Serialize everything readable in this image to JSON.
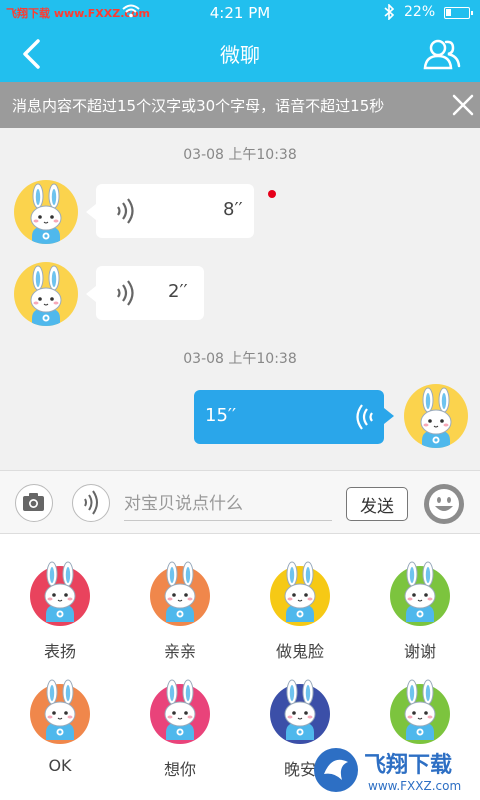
{
  "status_bar": {
    "carrier": "飞翔下载 www.FXXZ.com",
    "time": "4:21 PM",
    "battery_text": "22%",
    "battery_level": 0.22
  },
  "header": {
    "title": "微聊",
    "back_icon": "chevron-left-icon",
    "contacts_icon": "contacts-icon"
  },
  "notice": {
    "text": "消息内容不超过15个汉字或30个字母，语音不超过15秒",
    "close_icon": "close-icon"
  },
  "messages": [
    {
      "timestamp": "03-08 上午10:38"
    },
    {
      "side": "left",
      "type": "voice",
      "duration": "8′′",
      "unread": true
    },
    {
      "side": "left",
      "type": "voice",
      "duration": "2′′",
      "unread": false
    },
    {
      "timestamp": "03-08 上午10:38"
    },
    {
      "side": "right",
      "type": "voice",
      "duration": "15′′",
      "unread": false
    }
  ],
  "input_bar": {
    "camera_icon": "camera-icon",
    "voice_icon": "voice-icon",
    "placeholder": "对宝贝说点什么",
    "send_label": "发送",
    "emoji_icon": "emoji-icon"
  },
  "stickers": [
    {
      "label": "表扬",
      "color": "#e9435d"
    },
    {
      "label": "亲亲",
      "color": "#f0874b"
    },
    {
      "label": "做鬼脸",
      "color": "#f6c915"
    },
    {
      "label": "谢谢",
      "color": "#7cc43e"
    },
    {
      "label": "OK",
      "color": "#f0874b"
    },
    {
      "label": "想你",
      "color": "#e9437a"
    },
    {
      "label": "晚安",
      "color": "#3b4fa8"
    },
    {
      "label": "",
      "color": "#7cc43e"
    }
  ],
  "watermark": {
    "text": "飞翔下载",
    "url": "www.FXXZ.com"
  },
  "colors": {
    "primary": "#22bfee",
    "bubble_out": "#2aa6ea",
    "notice_bg": "#9b9b9b",
    "unread_dot": "#e6001a"
  }
}
